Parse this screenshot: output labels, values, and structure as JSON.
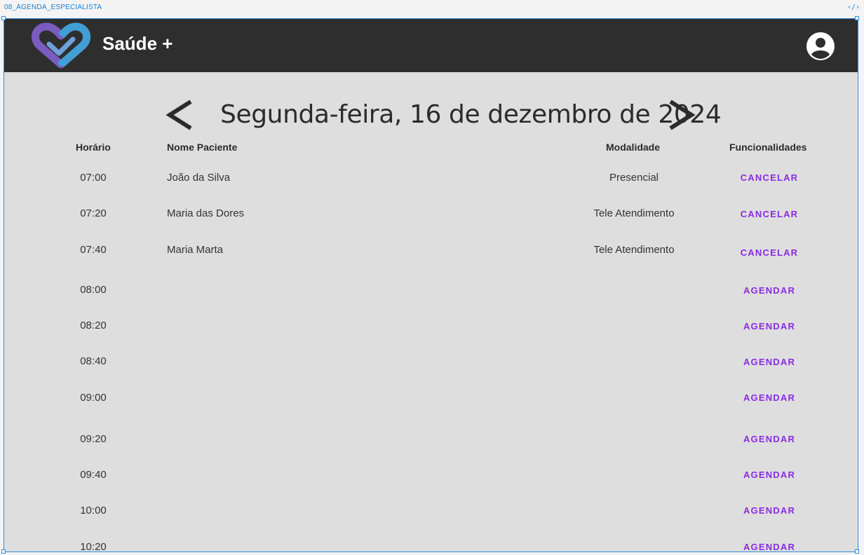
{
  "canvas": {
    "frame_label": "08_AGENDA_ESPECIALISTA",
    "code_icon_glyph": "‹/›"
  },
  "header": {
    "title": "Saúde +",
    "logo": "heart-logo",
    "account_icon": "account-circle-icon",
    "colors": {
      "background": "#2e2e2e",
      "logo_purple": "#7a5bbf",
      "logo_blue": "#3ba6d6"
    }
  },
  "date_nav": {
    "date": "Segunda-feira, 16 de dezembro de 2024",
    "prev_icon": "chevron-left-icon",
    "next_icon": "chevron-right-icon"
  },
  "table": {
    "headers": {
      "time": "Horário",
      "patient": "Nome Paciente",
      "modality": "Modalidade",
      "actions": "Funcionalidades"
    },
    "rows": [
      {
        "time": "07:00",
        "patient": "João da Silva",
        "modality": "Presencial",
        "action": "CANCELAR"
      },
      {
        "time": "07:20",
        "patient": "Maria das Dores",
        "modality": "Tele Atendimento",
        "action": "CANCELAR"
      },
      {
        "time": "07:40",
        "patient": "Maria Marta",
        "modality": "Tele Atendimento",
        "action": "CANCELAR"
      },
      {
        "time": "08:00",
        "patient": "",
        "modality": "",
        "action": "AGENDAR"
      },
      {
        "time": "08:20",
        "patient": "",
        "modality": "",
        "action": "AGENDAR"
      },
      {
        "time": "08:40",
        "patient": "",
        "modality": "",
        "action": "AGENDAR"
      },
      {
        "time": "09:00",
        "patient": "",
        "modality": "",
        "action": "AGENDAR"
      },
      {
        "time": "09:20",
        "patient": "",
        "modality": "",
        "action": "AGENDAR"
      },
      {
        "time": "09:40",
        "patient": "",
        "modality": "",
        "action": "AGENDAR"
      },
      {
        "time": "10:00",
        "patient": "",
        "modality": "",
        "action": "AGENDAR"
      },
      {
        "time": "10:20",
        "patient": "",
        "modality": "",
        "action": "AGENDAR"
      }
    ]
  },
  "theme": {
    "page_bg": "#dedede",
    "text": "#2b2b2b",
    "action_color": "#8a2be2",
    "selection_color": "#2b8fe0"
  }
}
